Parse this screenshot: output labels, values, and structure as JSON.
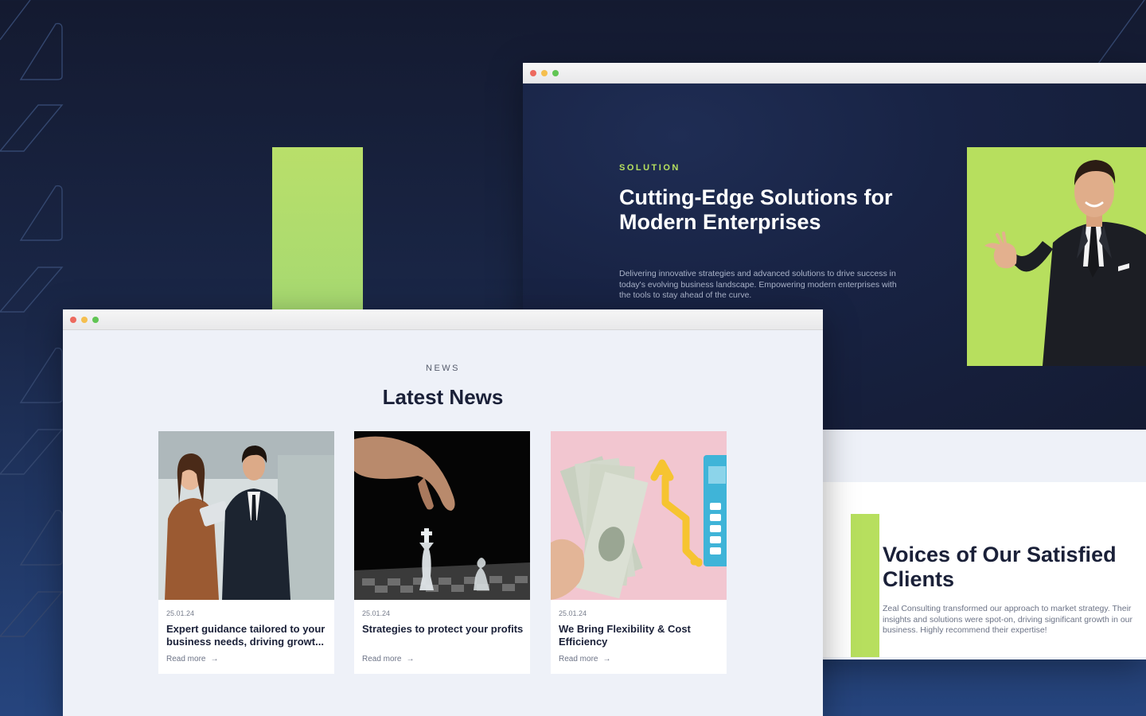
{
  "windows": {
    "control_colors": {
      "close": "#ed6a5e",
      "minimize": "#f5bf4f",
      "maximize": "#61c554"
    }
  },
  "solution": {
    "kicker": "SOLUTION",
    "title": "Cutting-Edge Solutions for Modern Enterprises",
    "description": "Delivering innovative strategies and advanced solutions to drive success in today's evolving business landscape. Empowering modern enterprises with the tools to stay ahead of the curve."
  },
  "testimonials": {
    "title": "Voices of Our Satisfied Clients",
    "quote": "Zeal Consulting transformed our approach to market strategy. Their insights and solutions were spot-on, driving significant growth in our business. Highly recommend their expertise!"
  },
  "news": {
    "kicker": "NEWS",
    "title": "Latest News",
    "articles": [
      {
        "date": "25.01.24",
        "title": "Expert guidance tailored to your business needs, driving growt...",
        "link": "Read more"
      },
      {
        "date": "25.01.24",
        "title": "Strategies to protect your profits",
        "link": "Read more"
      },
      {
        "date": "25.01.24",
        "title": "We Bring Flexibility & Cost Efficiency",
        "link": "Read more"
      }
    ]
  },
  "accent_colors": {
    "brand_green": "#b7df5e",
    "navy": "#141b33"
  }
}
